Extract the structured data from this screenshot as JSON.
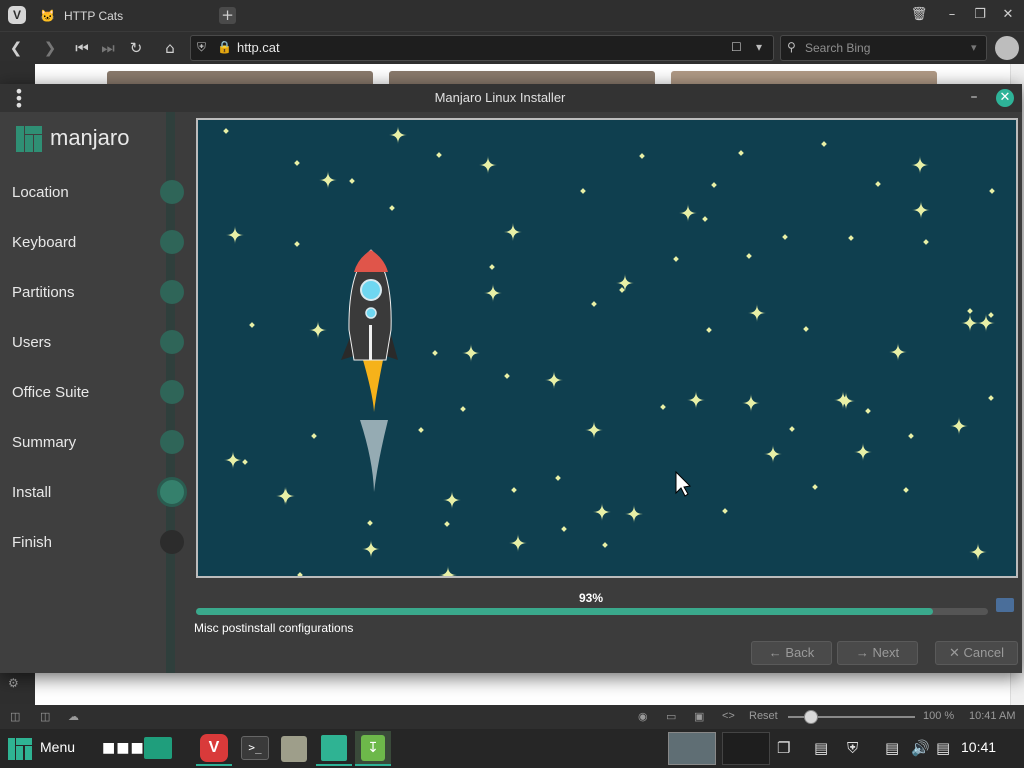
{
  "browser": {
    "tab_title": "HTTP Cats",
    "tab_icon": "cat-icon",
    "url": "http.cat",
    "search_placeholder": "Search Bing"
  },
  "installer": {
    "window_title": "Manjaro Linux Installer",
    "logo_text": "manjaro",
    "steps": [
      {
        "label": "Location",
        "state": "done"
      },
      {
        "label": "Keyboard",
        "state": "done"
      },
      {
        "label": "Partitions",
        "state": "done"
      },
      {
        "label": "Users",
        "state": "done"
      },
      {
        "label": "Office Suite",
        "state": "done"
      },
      {
        "label": "Summary",
        "state": "done"
      },
      {
        "label": "Install",
        "state": "active"
      },
      {
        "label": "Finish",
        "state": "pending"
      }
    ],
    "progress_text": "93%",
    "progress_value": 0.93,
    "status_text": "Misc postinstall configurations",
    "back_label": "Back",
    "next_label": "Next",
    "cancel_label": "Cancel",
    "accent_color": "#2eb398",
    "slide_background": "#0f3f4f"
  },
  "statusbar": {
    "reset_label": "Reset",
    "zoom_text": "100 %",
    "time": "10:41 AM"
  },
  "taskbar": {
    "menu_label": "Menu",
    "clock": "10:41"
  }
}
